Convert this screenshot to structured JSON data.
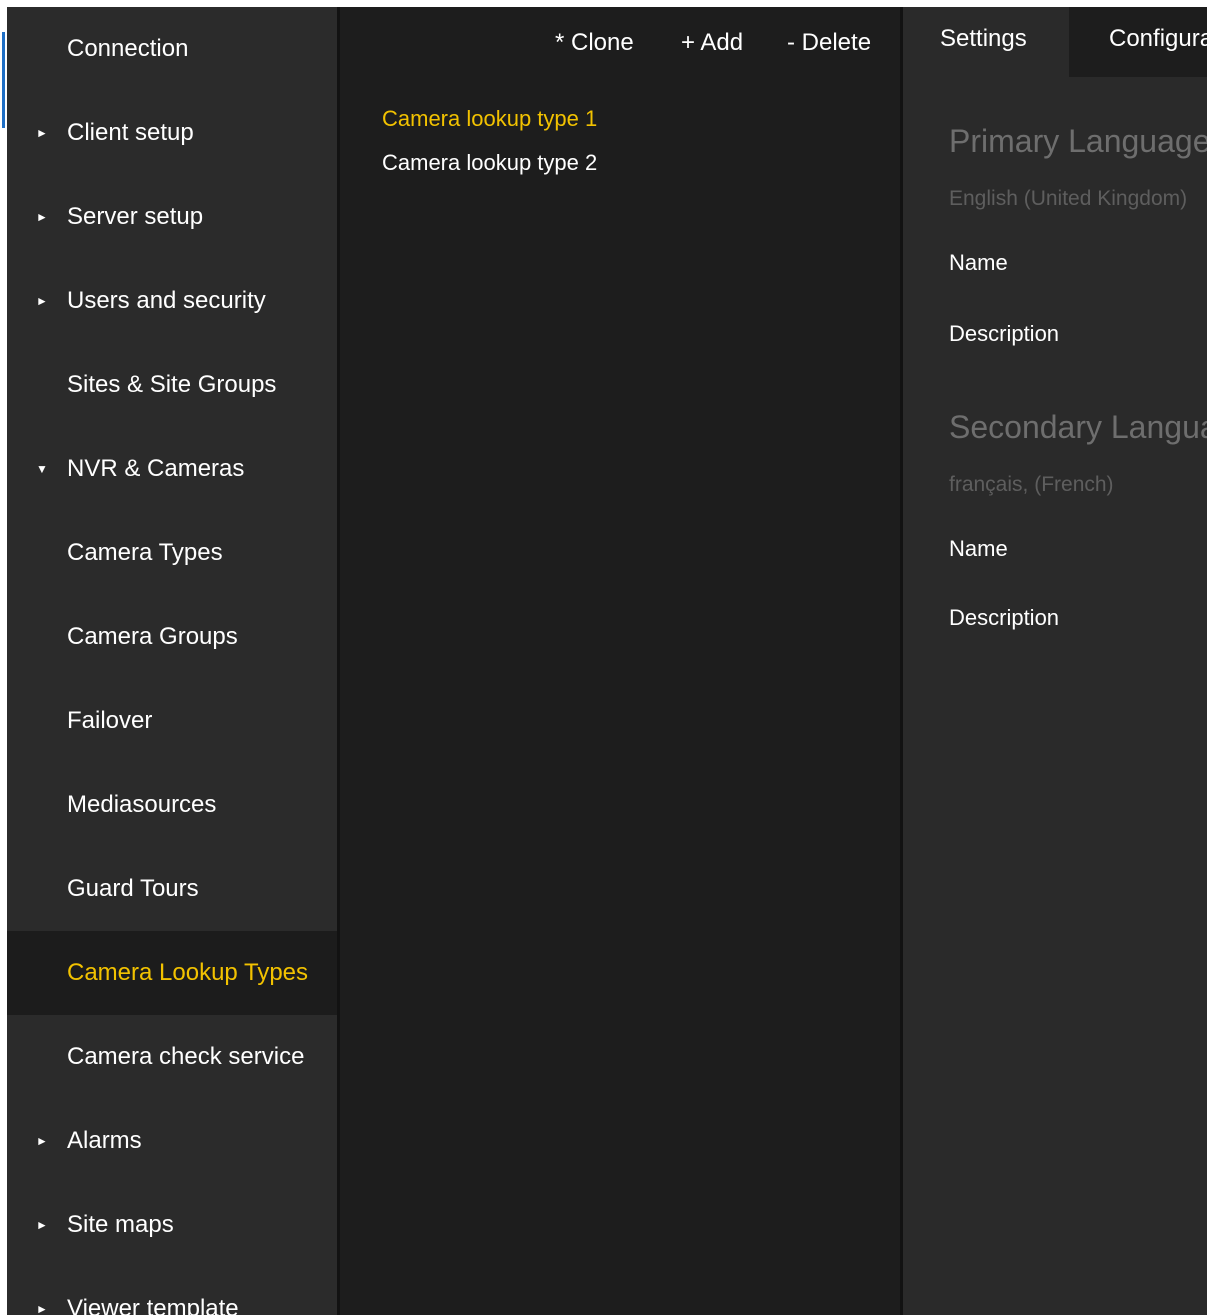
{
  "sidebar": {
    "items": [
      {
        "label": "Connection",
        "arrow": ""
      },
      {
        "label": "Client setup",
        "arrow": "►"
      },
      {
        "label": "Server setup",
        "arrow": "►"
      },
      {
        "label": "Users and security",
        "arrow": "►"
      },
      {
        "label": "Sites & Site Groups",
        "arrow": ""
      },
      {
        "label": "NVR & Cameras",
        "arrow": "▼"
      },
      {
        "label": "Camera Types",
        "arrow": ""
      },
      {
        "label": "Camera Groups",
        "arrow": ""
      },
      {
        "label": "Failover",
        "arrow": ""
      },
      {
        "label": "Mediasources",
        "arrow": ""
      },
      {
        "label": "Guard Tours",
        "arrow": ""
      },
      {
        "label": "Camera Lookup Types",
        "arrow": "",
        "active": true
      },
      {
        "label": "Camera check service",
        "arrow": ""
      },
      {
        "label": "Alarms",
        "arrow": "►"
      },
      {
        "label": "Site maps",
        "arrow": "►"
      },
      {
        "label": "Viewer template",
        "arrow": "►"
      }
    ]
  },
  "toolbar": {
    "clone_label": "* Clone",
    "add_label": "+ Add",
    "delete_label": "- Delete"
  },
  "list": {
    "items": [
      {
        "label": "Camera lookup type 1",
        "selected": true
      },
      {
        "label": "Camera lookup type 2",
        "selected": false
      }
    ]
  },
  "tabs": {
    "settings_label": "Settings",
    "configuration_label": "Configuration"
  },
  "details": {
    "primary": {
      "heading": "Primary Language",
      "language": "English (United Kingdom)",
      "name_label": "Name",
      "description_label": "Description"
    },
    "secondary": {
      "heading": "Secondary Language",
      "language": "français, (French)",
      "name_label": "Name",
      "description_label": "Description"
    }
  },
  "colors": {
    "accent": "#f2c200",
    "sidebar_bg": "#2b2b2b",
    "list_bg": "#1d1d1d",
    "details_bg": "#2a2a2a"
  }
}
